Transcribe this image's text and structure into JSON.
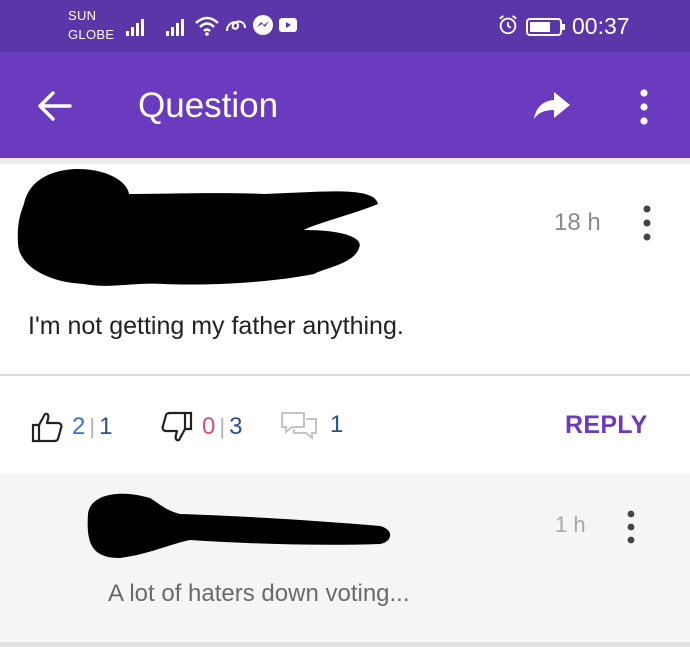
{
  "status_bar": {
    "carrier_line1": "SUN",
    "carrier_line2": "GLOBE",
    "time": "00:37",
    "icons": [
      "signal-icon",
      "signal-icon",
      "wifi-icon",
      "link-icon",
      "messenger-icon",
      "youtube-icon",
      "alarm-icon",
      "battery-icon"
    ]
  },
  "app_bar": {
    "title": "Question",
    "icons": [
      "back-arrow-icon",
      "share-icon",
      "more-vert-icon"
    ],
    "background": "#6a3bbf"
  },
  "question": {
    "time": "18 h",
    "text": "I'm not getting my father anything."
  },
  "actions": {
    "likes_a": "2",
    "likes_b": "1",
    "dislikes_a": "0",
    "dislikes_b": "3",
    "comments": "1",
    "reply_label": "REPLY"
  },
  "comment": {
    "time": "1 h",
    "text": "A lot of haters down voting..."
  },
  "colors": {
    "accent": "#6a3bbf",
    "status_bar": "#5a36a8",
    "like": "#3b6fd0",
    "dislike": "#d84b7e"
  }
}
